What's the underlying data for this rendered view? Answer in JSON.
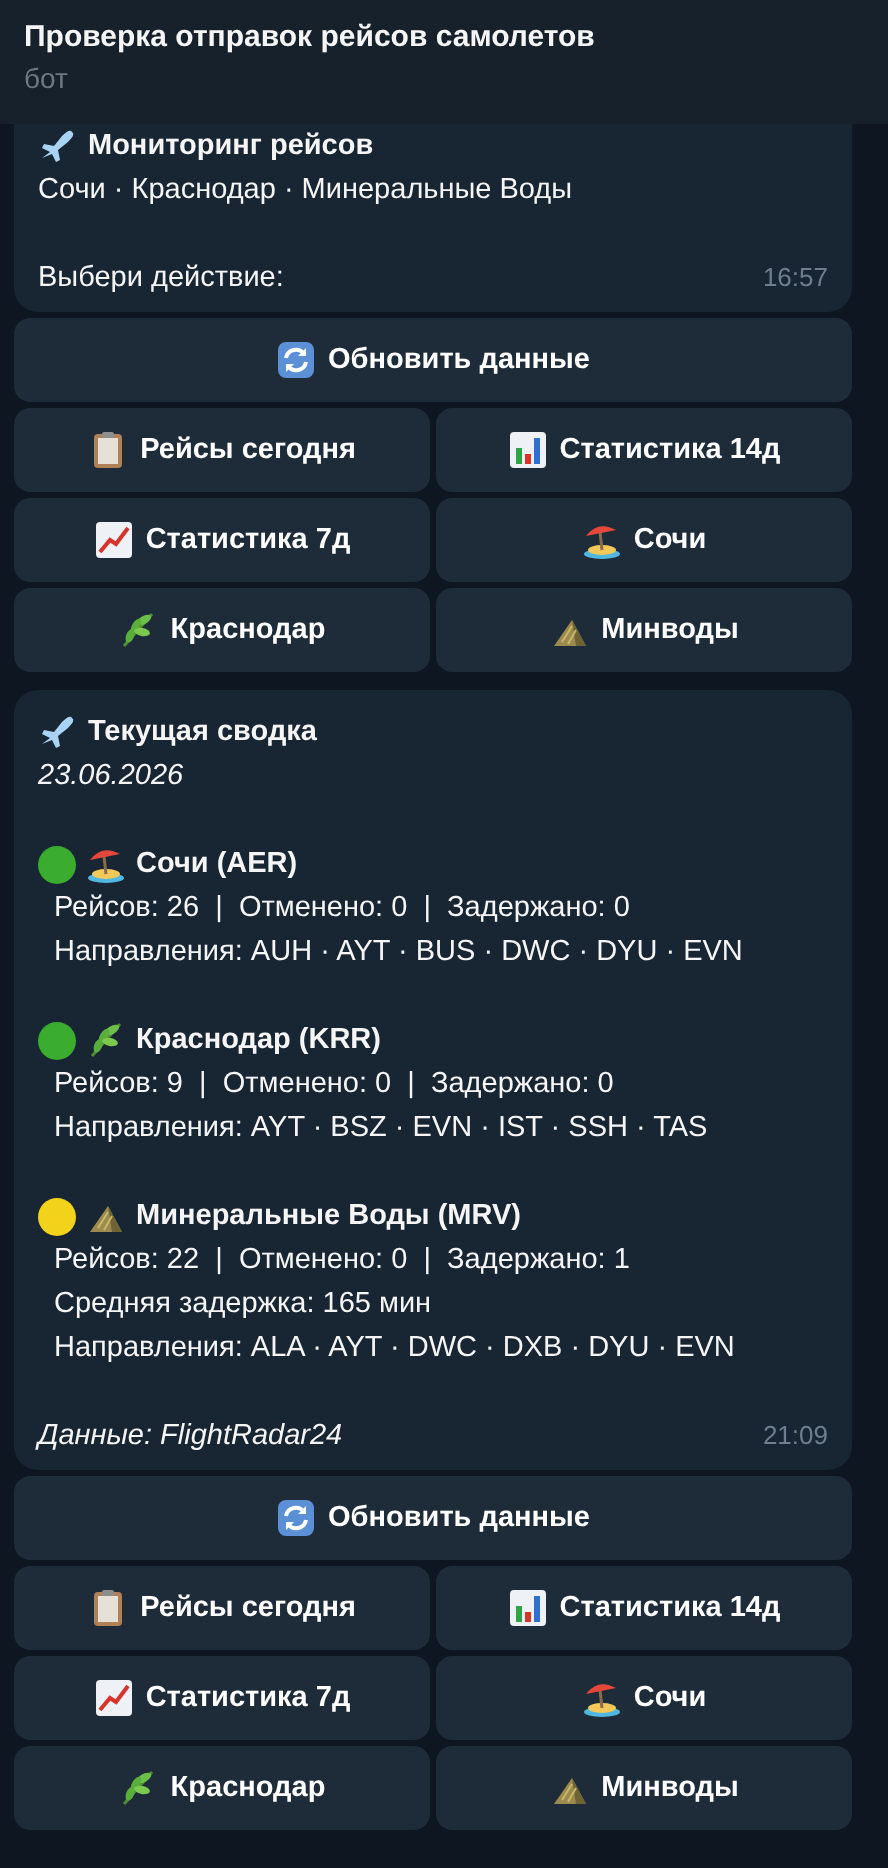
{
  "header": {
    "title": "Проверка отправок рейсов самолетов",
    "subtitle": "бот"
  },
  "messages": [
    {
      "title": "Мониторинг рейсов",
      "lines": [
        "Сочи · Краснодар · Минеральные Воды"
      ],
      "footer": "Выбери действие:",
      "footer_italic": false,
      "time": "16:57",
      "keyboard": [
        [
          {
            "kind": "refresh",
            "label": "Обновить данные"
          }
        ],
        [
          {
            "kind": "clipboard",
            "label": "Рейсы сегодня"
          },
          {
            "kind": "bars",
            "label": "Статистика 14д"
          }
        ],
        [
          {
            "kind": "trend",
            "label": "Статистика 7д"
          },
          {
            "kind": "beach",
            "label": "Сочи"
          }
        ],
        [
          {
            "kind": "leaf",
            "label": "Краснодар"
          },
          {
            "kind": "mountain",
            "label": "Минводы"
          }
        ]
      ]
    },
    {
      "title": "Текущая сводка",
      "date": "23.06.2026",
      "cities": [
        {
          "color": "#3aac2f",
          "kind": "beach",
          "name": "Сочи (AER)",
          "lines": [
            "Рейсов: 26  |  Отменено: 0  |  Задержано: 0",
            "Направления: AUH · AYT · BUS · DWC · DYU · EVN"
          ]
        },
        {
          "color": "#3aac2f",
          "kind": "leaf",
          "name": "Краснодар (KRR)",
          "lines": [
            "Рейсов: 9  |  Отменено: 0  |  Задержано: 0",
            "Направления: AYT · BSZ · EVN · IST · SSH · TAS"
          ]
        },
        {
          "color": "#f2d21b",
          "kind": "mountain",
          "name": "Минеральные Воды (MRV)",
          "lines": [
            "Рейсов: 22  |  Отменено: 0  |  Задержано: 1",
            "Средняя задержка: 165 мин",
            "Направления: ALA · AYT · DWC · DXB · DYU · EVN"
          ]
        }
      ],
      "footer": "Данные: FlightRadar24",
      "footer_italic": true,
      "time": "21:09",
      "keyboard": [
        [
          {
            "kind": "refresh",
            "label": "Обновить данные"
          }
        ],
        [
          {
            "kind": "clipboard",
            "label": "Рейсы сегодня"
          },
          {
            "kind": "bars",
            "label": "Статистика 14д"
          }
        ],
        [
          {
            "kind": "trend",
            "label": "Статистика 7д"
          },
          {
            "kind": "beach",
            "label": "Сочи"
          }
        ],
        [
          {
            "kind": "leaf",
            "label": "Краснодар"
          },
          {
            "kind": "mountain",
            "label": "Минводы"
          }
        ]
      ]
    }
  ]
}
